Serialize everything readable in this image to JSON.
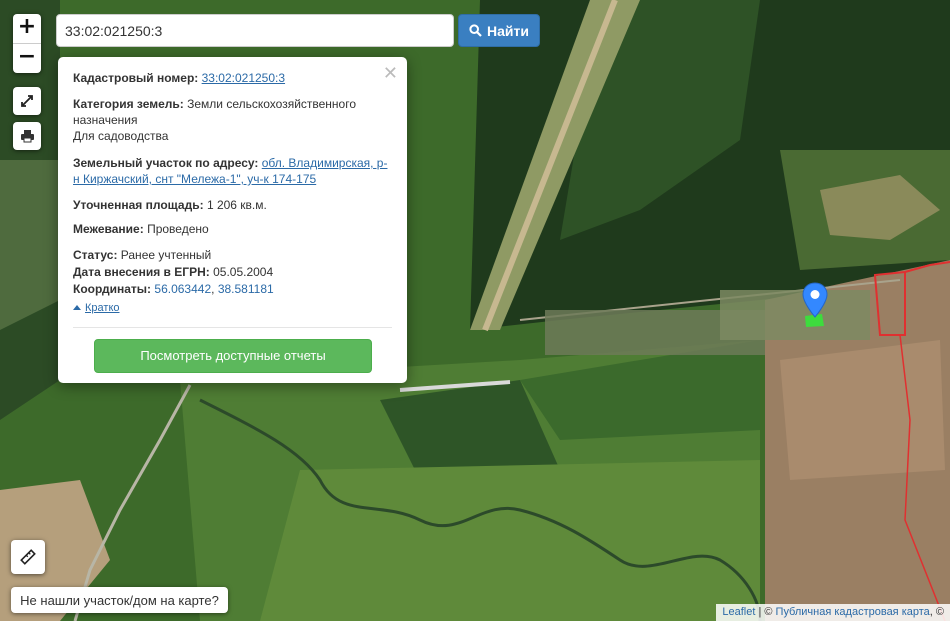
{
  "search": {
    "value": "33:02:021250:3",
    "button_label": "Найти"
  },
  "controls": {
    "zoom_in": "+",
    "zoom_out": "−"
  },
  "popup": {
    "cadastral_label": "Кадастровый номер:",
    "cadastral_value": "33:02:021250:3",
    "category_label": "Категория земель:",
    "category_value": "Земли сельскохозяйственного назначения",
    "usage_value": "Для садоводства",
    "address_label": "Земельный участок по адресу:",
    "address_value": "обл. Владимирская, р-н Киржачский, снт \"Мележа-1\", уч-к 174-175",
    "area_label": "Уточненная площадь:",
    "area_value": "1 206 кв.м.",
    "survey_label": "Межевание:",
    "survey_value": "Проведено",
    "status_label": "Статус:",
    "status_value": "Ранее учтенный",
    "egrn_label": "Дата внесения в ЕГРН:",
    "egrn_value": "05.05.2004",
    "coords_label": "Координаты:",
    "lat": "56.063442",
    "lon": "38.581181",
    "coords_sep": ",",
    "brief_label": "Кратко",
    "reports_button": "Посмотреть доступные отчеты"
  },
  "not_found_button": "Не нашли участок/дом на карте?",
  "attribution": {
    "leaflet": "Leaflet",
    "separator": "| ©",
    "map_link": "Публичная кадастровая карта",
    "trailing": ", ©"
  },
  "icons": {
    "search": "magnifier-icon",
    "fullscreen": "fullscreen-icon",
    "print": "printer-icon",
    "ruler": "ruler-icon",
    "close": "close-icon",
    "marker": "map-marker-icon"
  },
  "colors": {
    "accent_blue": "#3a7fc1",
    "link_blue": "#2b6aa7",
    "button_green": "#5cb85c",
    "marker_blue": "#3388ff",
    "boundary_red": "#e03030"
  }
}
